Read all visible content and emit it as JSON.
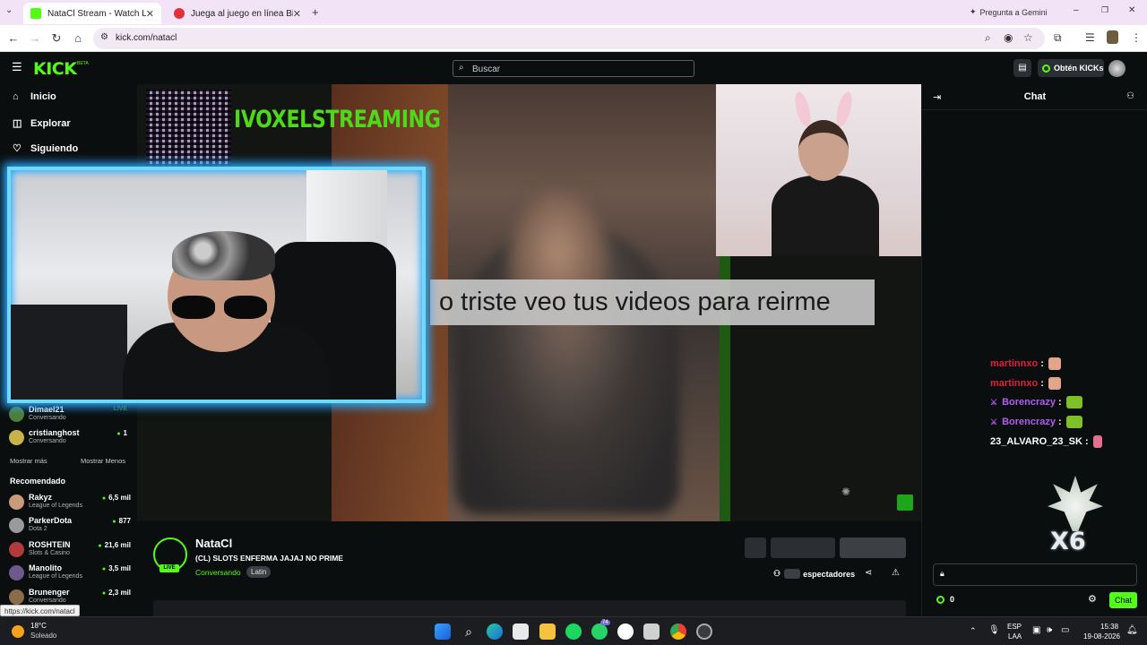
{
  "browser": {
    "tabs": [
      {
        "title": "NataCl Stream - Watch Live on",
        "active": true,
        "favicon_color": "#53fc18"
      },
      {
        "title": "Juega al juego en línea Big Bas",
        "active": false,
        "favicon_color": "#e0303a"
      }
    ],
    "new_tab": "+",
    "gemini": "Pregunta a Gemini",
    "url": "kick.com/natacl"
  },
  "header": {
    "logo": "KICK",
    "logo_tag": "BETA",
    "search_placeholder": "Buscar",
    "kicks_button": "Obtén KICKs"
  },
  "sidebar": {
    "nav": [
      {
        "label": "Inicio",
        "icon": "home-icon"
      },
      {
        "label": "Explorar",
        "icon": "compass-icon"
      },
      {
        "label": "Siguiendo",
        "icon": "heart-icon"
      }
    ],
    "following": [
      {
        "name": "Dimael21",
        "category": "Conversando",
        "status": "LIVE",
        "color": "#4e7d3a"
      },
      {
        "name": "cristianghost",
        "category": "Conversando",
        "viewers": "1",
        "color": "#c8b24a"
      }
    ],
    "show_more": "Mostrar más",
    "show_less": "Mostrar Menos",
    "recommended_title": "Recomendado",
    "recommended": [
      {
        "name": "Rakyz",
        "category": "League of Legends",
        "viewers": "6,5 mil",
        "color": "#c89b7b"
      },
      {
        "name": "ParkerDota",
        "category": "Dota 2",
        "viewers": "877",
        "color": "#9a9a9a"
      },
      {
        "name": "ROSHTEIN",
        "category": "Slots & Casino",
        "viewers": "21,6 mil",
        "color": "#b33a3a"
      },
      {
        "name": "Manolito",
        "category": "League of Legends",
        "viewers": "3,5 mil",
        "color": "#6e5a8a"
      },
      {
        "name": "Brunenger",
        "category": "Conversando",
        "viewers": "2,3 mil",
        "color": "#8a6b4a"
      }
    ]
  },
  "video": {
    "overlay_brand": "IVOXELSTREAMING",
    "caption": "o triste veo tus videos para reirme"
  },
  "stream": {
    "live_badge": "LIVE",
    "streamer": "NataCl",
    "title": "(CL) SLOTS ENFERMA JAJAJ NO PRIME",
    "category": "Conversando",
    "tag": "Latin",
    "viewers_label": "espectadores"
  },
  "chat": {
    "title": "Chat",
    "messages": [
      {
        "user": "martinnxo",
        "color": "#e0203a",
        "badge": false,
        "emote_color": "#e3a58a"
      },
      {
        "user": "martinnxo",
        "color": "#e0203a",
        "badge": false,
        "emote_color": "#e3a58a"
      },
      {
        "user": "Borencrazy",
        "color": "#b25cf0",
        "badge": true,
        "emote_color": "#7fbf2a"
      },
      {
        "user": "Borencrazy",
        "color": "#b25cf0",
        "badge": true,
        "emote_color": "#7fbf2a"
      },
      {
        "user": "23_ALVARO_23_SK",
        "color": "#ffffff",
        "badge": false,
        "emote_color": "#e46f8e"
      }
    ],
    "sticker_text": "X6",
    "kicks_count": "0",
    "send_label": "Chat"
  },
  "status_link": "https://kick.com/natacl",
  "taskbar": {
    "temperature": "18°C",
    "weather": "Soleado",
    "language": "ESP",
    "layout": "LAA",
    "time": "15:38",
    "date": "19-08-2026",
    "whatsapp_badge": "74"
  },
  "colors": {
    "accent": "#53fc18",
    "background": "#0b0e0f"
  }
}
